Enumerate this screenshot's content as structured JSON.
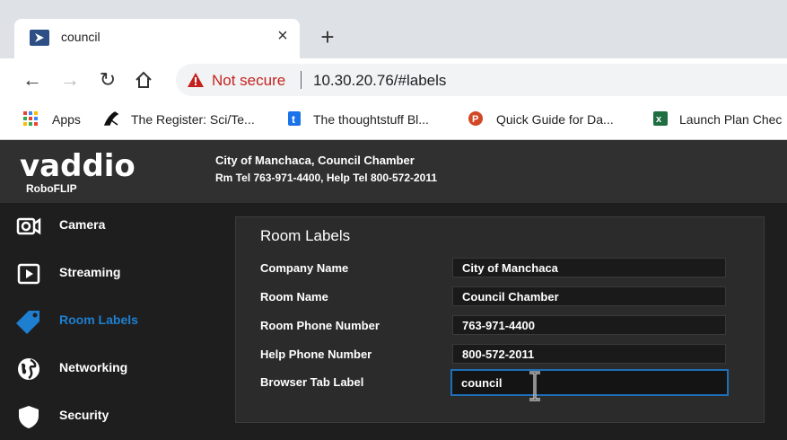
{
  "browser": {
    "tab_title": "council",
    "tab_close": "×",
    "new_tab": "+",
    "security_label": "Not secure",
    "url": "10.30.20.76/#labels",
    "bookmarks": [
      {
        "label": "Apps",
        "icon": "apps-grid-icon"
      },
      {
        "label": "The Register: Sci/Te...",
        "icon": "register-icon"
      },
      {
        "label": "The thoughtstuff Bl...",
        "icon": "thoughtstuff-icon"
      },
      {
        "label": "Quick Guide for Da...",
        "icon": "powerpoint-icon"
      },
      {
        "label": "Launch Plan Chec",
        "icon": "excel-icon"
      }
    ]
  },
  "app": {
    "brand": "vaddio",
    "product": "RoboFLIP",
    "header_line1": "City of Manchaca, Council Chamber",
    "header_line2": "Rm Tel 763-971-4400, Help Tel 800-572-2011",
    "accent_color": "#1e7fd1"
  },
  "sidebar": {
    "items": [
      {
        "label": "Camera",
        "icon": "camera-icon",
        "active": false
      },
      {
        "label": "Streaming",
        "icon": "play-icon",
        "active": false
      },
      {
        "label": "Room Labels",
        "icon": "tag-icon",
        "active": true
      },
      {
        "label": "Networking",
        "icon": "globe-icon",
        "active": false
      },
      {
        "label": "Security",
        "icon": "shield-icon",
        "active": false
      }
    ]
  },
  "room_labels": {
    "title": "Room Labels",
    "fields": [
      {
        "label": "Company Name",
        "value": "City of Manchaca"
      },
      {
        "label": "Room Name",
        "value": "Council Chamber"
      },
      {
        "label": "Room Phone Number",
        "value": "763-971-4400"
      },
      {
        "label": "Help Phone Number",
        "value": "800-572-2011"
      },
      {
        "label": "Browser Tab Label",
        "value": "council"
      }
    ]
  }
}
